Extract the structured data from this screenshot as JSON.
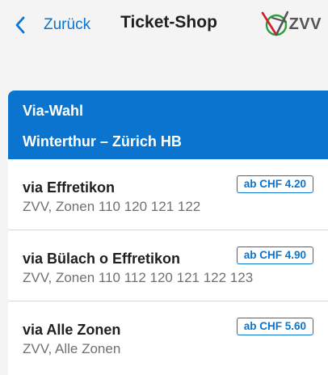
{
  "nav": {
    "back_label": "Zurück",
    "title": "Ticket-Shop",
    "logo_text": "ZVV"
  },
  "card": {
    "header_title": "Via-Wahl",
    "route": "Winterthur – Zürich HB"
  },
  "options": [
    {
      "title": "via Effretikon",
      "subtitle": "ZVV, Zonen 110 120 121 122",
      "price": "ab CHF 4.20"
    },
    {
      "title": "via Bülach o Effretikon",
      "subtitle": "ZVV, Zonen 110 112 120 121 122 123",
      "price": "ab CHF 4.90"
    },
    {
      "title": "via Alle Zonen",
      "subtitle": "ZVV, Alle Zonen",
      "price": "ab CHF 5.60"
    }
  ],
  "colors": {
    "accent": "#0a74cf",
    "background": "#f4f4f4",
    "logo_red": "#d7192f",
    "logo_green": "#2e9d3a"
  },
  "icons": {
    "back": "chevron-left-icon",
    "logo": "zvv-logo-icon"
  }
}
